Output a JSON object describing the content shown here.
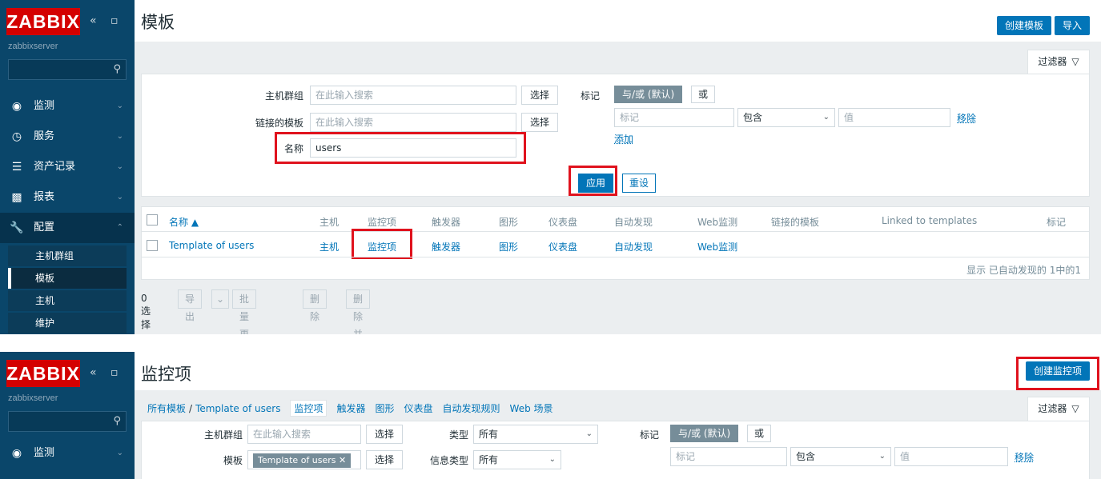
{
  "colors": {
    "brand_red": "#d40000",
    "sidebar": "#0a466a",
    "accent": "#0275b8",
    "highlight": "#e0121d"
  },
  "app": {
    "logo": "ZABBIX",
    "collapse_icon": "«",
    "kiosk_icon": "▫",
    "server": "zabbixserver"
  },
  "sidebar1": {
    "menu": [
      {
        "icon": "eye-icon",
        "label": "监测",
        "chevron": "⌄"
      },
      {
        "icon": "clock-icon",
        "label": "服务",
        "chevron": "⌄"
      },
      {
        "icon": "list-icon",
        "label": "资产记录",
        "chevron": "⌄"
      },
      {
        "icon": "bar-chart-icon",
        "label": "报表",
        "chevron": "⌄"
      },
      {
        "icon": "wrench-icon",
        "label": "配置",
        "chevron": "⌃"
      }
    ],
    "submenu": [
      "主机群组",
      "模板",
      "主机",
      "维护"
    ]
  },
  "sidebar2": {
    "menu": [
      {
        "icon": "eye-icon",
        "label": "监测",
        "chevron": "⌄"
      }
    ]
  },
  "templates": {
    "title": "模板",
    "create_btn": "创建模板",
    "import_btn": "导入",
    "filter_tab": "过滤器",
    "filter": {
      "host_group_label": "主机群组",
      "host_group_placeholder": "在此输入搜索",
      "linked_label": "链接的模板",
      "linked_placeholder": "在此输入搜索",
      "name_label": "名称",
      "name_value": "users",
      "select_btn": "选择",
      "tags_label": "标记",
      "and_or": "与/或 (默认)",
      "or": "或",
      "tag_placeholder": "标记",
      "contains": "包含",
      "value_placeholder": "值",
      "remove": "移除",
      "add": "添加",
      "apply": "应用",
      "reset": "重设"
    },
    "table": {
      "headers": [
        "名称 ▲",
        "主机",
        "监控项",
        "触发器",
        "图形",
        "仪表盘",
        "自动发现",
        "Web监测",
        "链接的模板",
        "Linked to templates",
        "标记"
      ],
      "row": [
        "Template of users",
        "主机",
        "监控项",
        "触发器",
        "图形",
        "仪表盘",
        "自动发现",
        "Web监测"
      ],
      "footer": "显示 已自动发现的 1中的1"
    },
    "actions": {
      "selected": "0 选择",
      "export": "导出",
      "export_caret": "⌄",
      "mass_update": "批量更新",
      "delete": "删除",
      "delete_clear": "删除并清除"
    }
  },
  "items": {
    "title": "监控项",
    "create_btn": "创建监控项",
    "filter_tab": "过滤器",
    "breadcrumbs": [
      "所有模板",
      "/",
      "Template of users",
      "监控项",
      "触发器",
      "图形",
      "仪表盘",
      "自动发现规则",
      "Web 场景"
    ],
    "filter": {
      "host_group_label": "主机群组",
      "host_group_placeholder": "在此输入搜索",
      "select_btn": "选择",
      "template_label": "模板",
      "template_value": "Template of users",
      "tag_close": "✕",
      "type_label": "类型",
      "type_value": "所有",
      "info_type_label": "信息类型",
      "info_type_value": "所有",
      "tags_label": "标记",
      "and_or": "与/或 (默认)",
      "or": "或",
      "tag_placeholder": "标记",
      "contains": "包含",
      "value_placeholder": "值",
      "remove": "移除"
    }
  }
}
